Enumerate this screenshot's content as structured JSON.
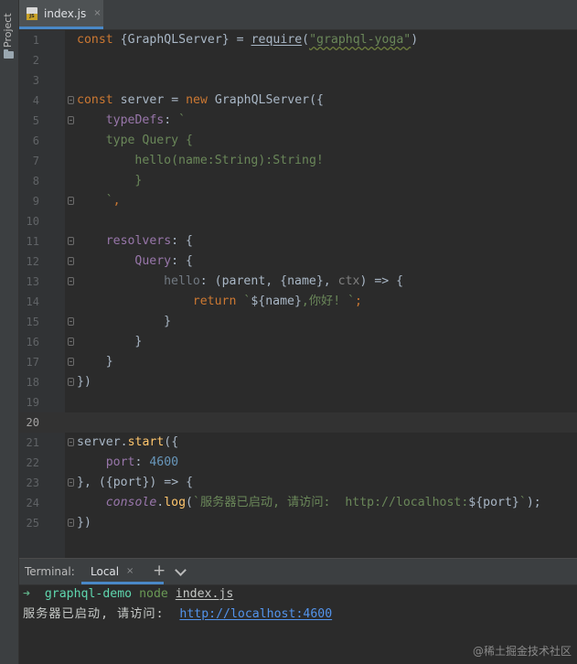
{
  "sidebar": {
    "project_label": "Project",
    "folder_icon": "folder-icon"
  },
  "tab": {
    "label": "index.js",
    "close": "×",
    "icon": "js-file-icon"
  },
  "editor": {
    "lines": [
      {
        "n": "1",
        "segs": [
          [
            "kw",
            "const "
          ],
          [
            "p",
            "{GraphQLServer} = "
          ],
          [
            "req",
            "require"
          ],
          [
            "p",
            "("
          ],
          [
            "sqg",
            "\"graphql-yoga\""
          ],
          [
            "p",
            ")"
          ]
        ],
        "indent": 0
      },
      {
        "n": "2",
        "segs": [],
        "indent": 0
      },
      {
        "n": "3",
        "segs": [],
        "indent": 0
      },
      {
        "n": "4",
        "segs": [
          [
            "kw",
            "const "
          ],
          [
            "p",
            "server = "
          ],
          [
            "kw",
            "new "
          ],
          [
            "p",
            "GraphQLServer({"
          ]
        ],
        "indent": 0,
        "fold": true
      },
      {
        "n": "5",
        "segs": [
          [
            "prop",
            "typeDefs"
          ],
          [
            "p",
            ": "
          ],
          [
            "tpl",
            "`"
          ]
        ],
        "indent": 1,
        "fold": true
      },
      {
        "n": "6",
        "segs": [
          [
            "tpl",
            "type Query {"
          ]
        ],
        "indent": 1
      },
      {
        "n": "7",
        "segs": [
          [
            "tpl",
            "hello(name:String):String!"
          ]
        ],
        "indent": 2
      },
      {
        "n": "8",
        "segs": [
          [
            "tpl",
            "}"
          ]
        ],
        "indent": 2
      },
      {
        "n": "9",
        "segs": [
          [
            "tpl",
            "`"
          ],
          [
            "kw",
            ","
          ]
        ],
        "indent": 1,
        "fold": true
      },
      {
        "n": "10",
        "segs": [],
        "indent": 0
      },
      {
        "n": "11",
        "segs": [
          [
            "prop",
            "resolvers"
          ],
          [
            "p",
            ": {"
          ]
        ],
        "indent": 1,
        "fold": true
      },
      {
        "n": "12",
        "segs": [
          [
            "prop",
            "Query"
          ],
          [
            "p",
            ": {"
          ]
        ],
        "indent": 2,
        "fold": true
      },
      {
        "n": "13",
        "segs": [
          [
            "fnp",
            "hello"
          ],
          [
            "p",
            ": (parent, {name}, "
          ],
          [
            "dim",
            "ctx"
          ],
          [
            "p",
            ") => {"
          ]
        ],
        "indent": 3,
        "fold": true
      },
      {
        "n": "14",
        "segs": [
          [
            "kw",
            "return "
          ],
          [
            "tpl",
            "`"
          ],
          [
            "p",
            "${name}"
          ],
          [
            "tpl",
            ",你好! `"
          ],
          [
            "kw",
            ";"
          ]
        ],
        "indent": 4
      },
      {
        "n": "15",
        "segs": [
          [
            "p",
            "}"
          ]
        ],
        "indent": 3,
        "fold": true
      },
      {
        "n": "16",
        "segs": [
          [
            "p",
            "}"
          ]
        ],
        "indent": 2,
        "fold": true
      },
      {
        "n": "17",
        "segs": [
          [
            "p",
            "}"
          ]
        ],
        "indent": 1,
        "fold": true
      },
      {
        "n": "18",
        "segs": [
          [
            "p",
            "})"
          ]
        ],
        "indent": 0,
        "fold": true
      },
      {
        "n": "19",
        "segs": [],
        "indent": 0
      },
      {
        "n": "20",
        "segs": [],
        "indent": 0,
        "current": true
      },
      {
        "n": "21",
        "segs": [
          [
            "p",
            "server."
          ],
          [
            "fn",
            "start"
          ],
          [
            "p",
            "({"
          ]
        ],
        "indent": 0,
        "fold": true
      },
      {
        "n": "22",
        "segs": [
          [
            "prop",
            "port"
          ],
          [
            "p",
            ": "
          ],
          [
            "num",
            "4600"
          ]
        ],
        "indent": 1
      },
      {
        "n": "23",
        "segs": [
          [
            "p",
            "}, ({port}) => {"
          ]
        ],
        "indent": 0,
        "fold": true
      },
      {
        "n": "24",
        "segs": [
          [
            "ital",
            "console"
          ],
          [
            "p",
            "."
          ],
          [
            "fn",
            "log"
          ],
          [
            "p",
            "("
          ],
          [
            "tpl",
            "`服务器已启动, 请访问:  http://localhost:"
          ],
          [
            "p",
            "${port}"
          ],
          [
            "tpl",
            "`"
          ],
          [
            "p",
            ");"
          ]
        ],
        "indent": 1
      },
      {
        "n": "25",
        "segs": [
          [
            "p",
            "})"
          ]
        ],
        "indent": 0,
        "fold": true
      }
    ]
  },
  "terminal": {
    "title": "Terminal:",
    "tab_label": "Local",
    "tab_close": "×",
    "plus": "+",
    "prompt_arrow": "➜",
    "prompt_dir": "graphql-demo",
    "prompt_cmd": "node",
    "prompt_arg": "index.js",
    "output_text": "服务器已启动, 请访问: ",
    "output_link": "http://localhost:4600"
  },
  "watermark": "@稀土掘金技术社区",
  "colors": {
    "accent": "#4a88c7",
    "keyword": "#cc7832",
    "string": "#6a8759",
    "property": "#9876aa",
    "number": "#6897bb",
    "function": "#ffc66d"
  }
}
